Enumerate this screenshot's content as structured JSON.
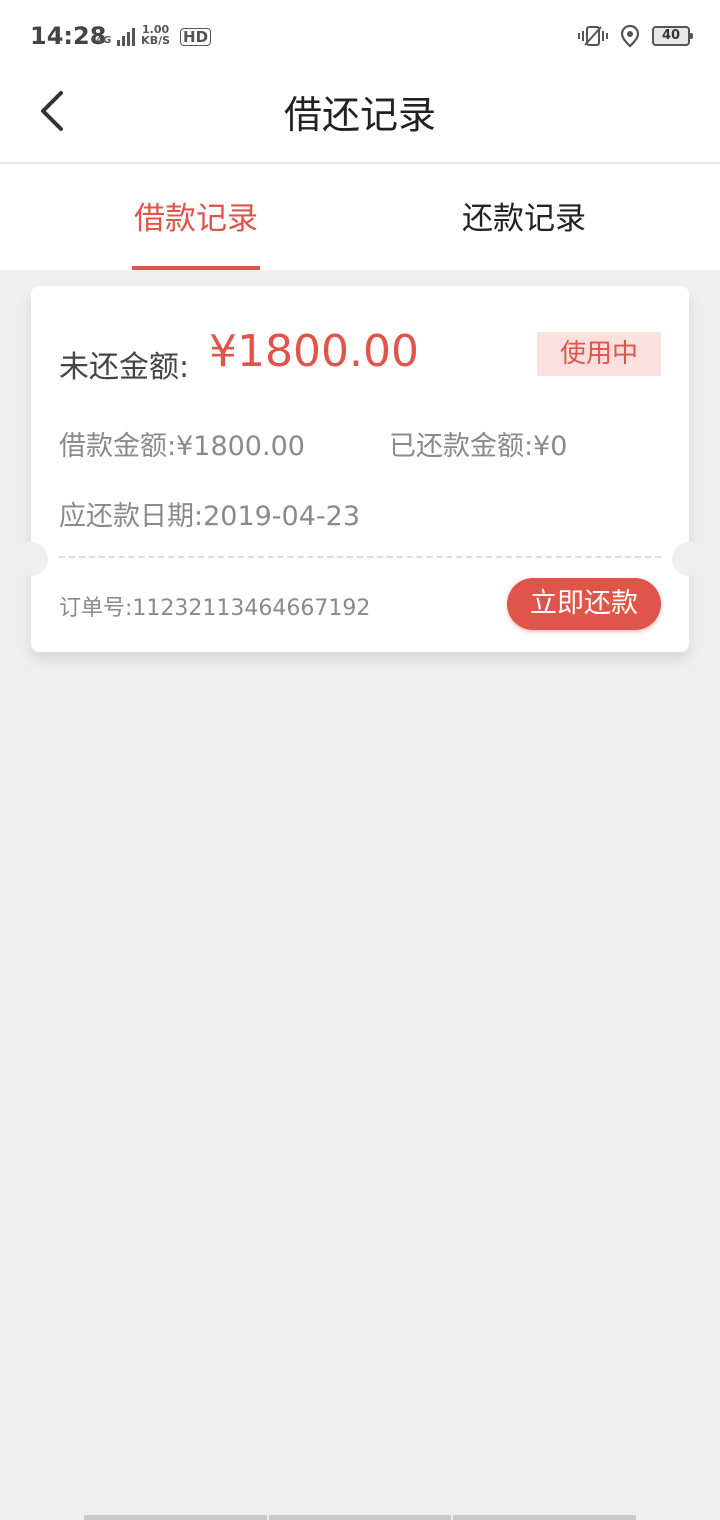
{
  "status_bar": {
    "time": "14:28",
    "network_type": "4G",
    "speed_value": "1.00",
    "speed_unit": "KB/S",
    "hd_label": "HD",
    "battery": "40"
  },
  "header": {
    "title": "借还记录"
  },
  "tabs": [
    {
      "label": "借款记录",
      "active": true
    },
    {
      "label": "还款记录",
      "active": false
    }
  ],
  "record": {
    "outstanding_label": "未还金额:",
    "outstanding_amount": "¥1800.00",
    "status": "使用中",
    "loan_amount_text": "借款金额:¥1800.00",
    "repaid_amount_text": "已还款金额:¥0",
    "due_date_text": "应还款日期:2019-04-23",
    "order_no_text": "订单号:11232113464667192",
    "repay_button_label": "立即还款"
  },
  "colors": {
    "accent": "#e0544a",
    "badge_bg": "#fbe0de",
    "page_bg": "#efefef"
  }
}
